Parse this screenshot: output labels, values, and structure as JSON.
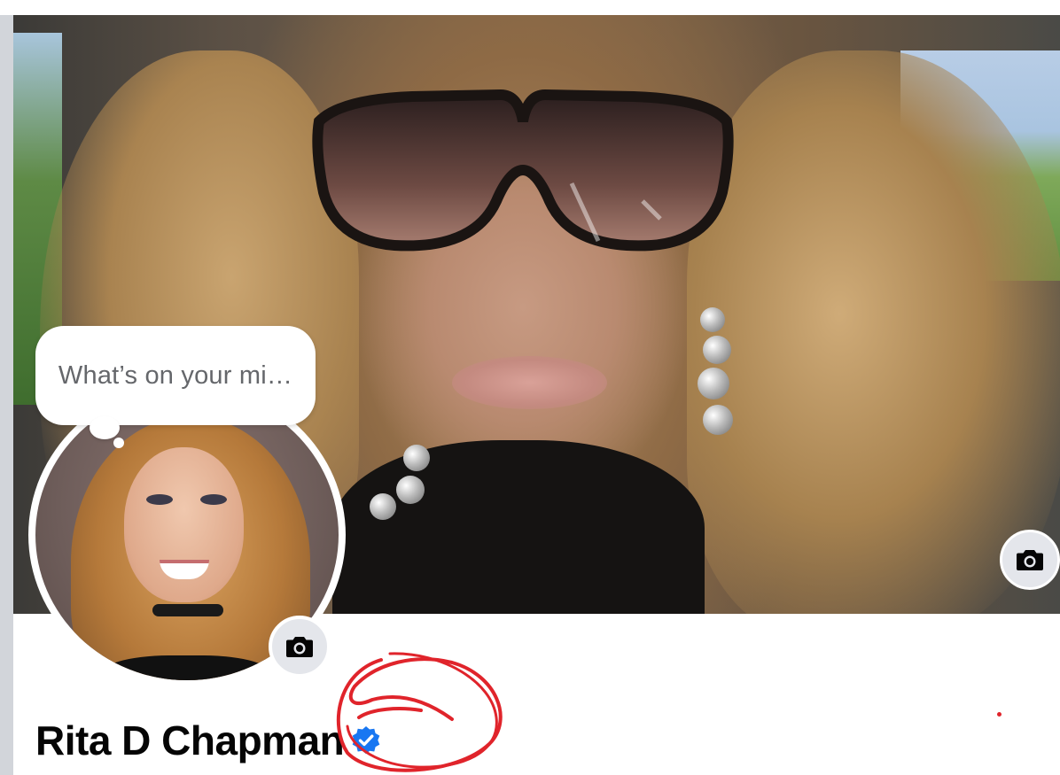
{
  "profile": {
    "name": "Rita D Chapman",
    "verified": true
  },
  "composer": {
    "placeholder": "What’s on your mi…"
  },
  "icons": {
    "cover_camera": "camera-icon",
    "avatar_camera": "camera-icon",
    "verified_badge": "verified-badge-icon"
  },
  "colors": {
    "verified_blue": "#1877f2",
    "annotation_red": "#e0242b",
    "camera_button_bg": "#e4e6eb",
    "placeholder_text": "#65676b"
  }
}
